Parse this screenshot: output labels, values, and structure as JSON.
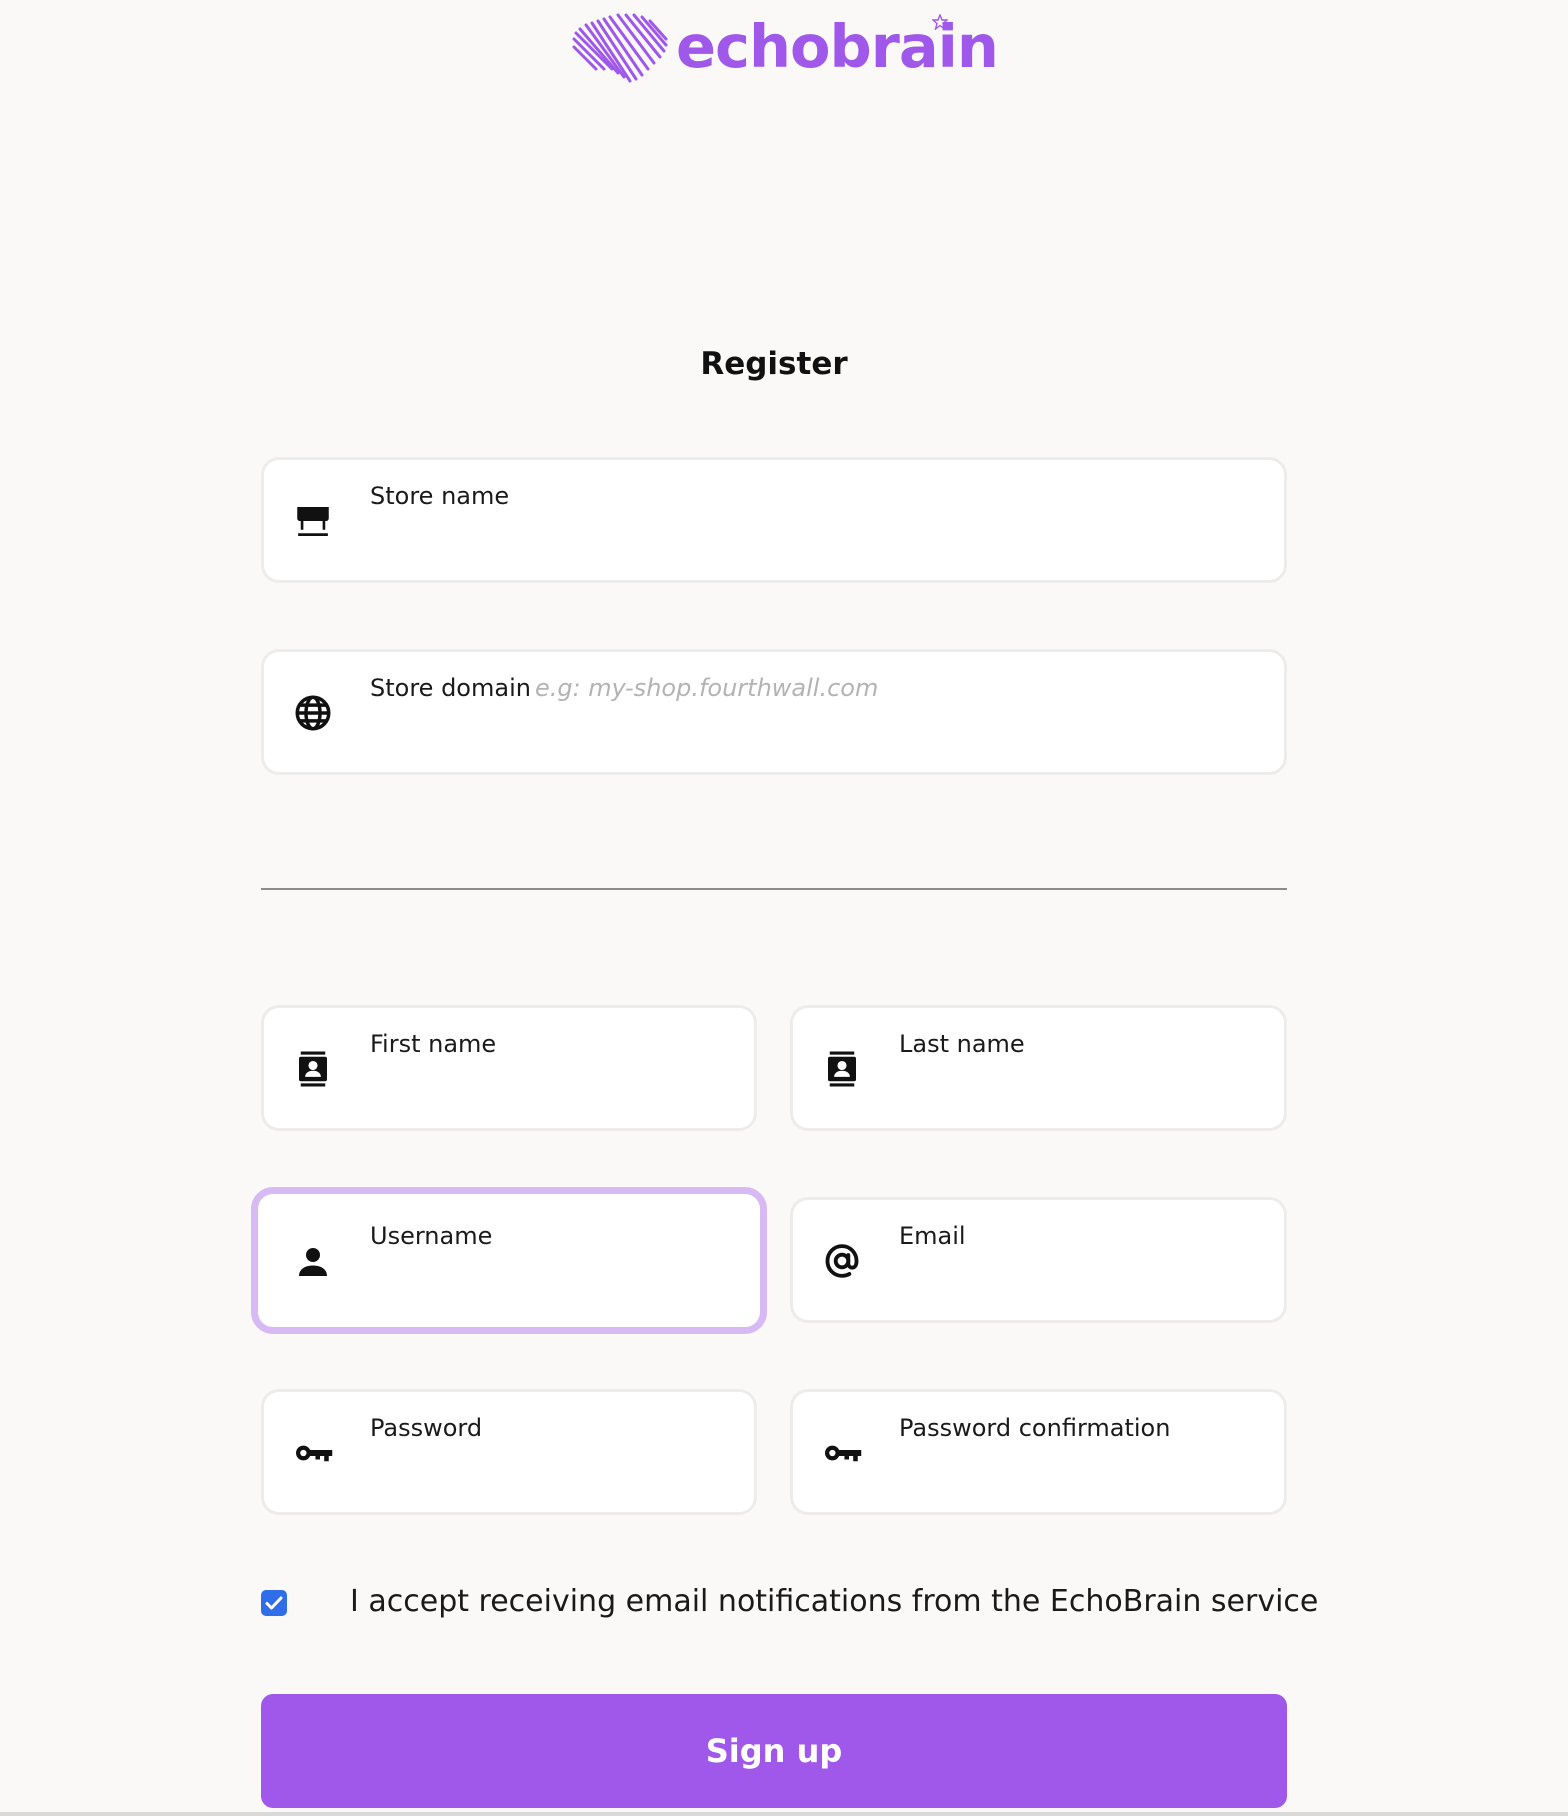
{
  "brand": {
    "name": "echobrain",
    "logo_icon": "soundwave-heart-icon",
    "accent_color": "#9f58ea"
  },
  "form": {
    "title": "Register",
    "store_name": {
      "label": "Store name",
      "icon": "storefront-icon",
      "value": ""
    },
    "store_domain": {
      "label": "Store domain",
      "hint": "e.g: my-shop.fourthwall.com",
      "icon": "globe-icon",
      "value": ""
    },
    "first_name": {
      "label": "First name",
      "icon": "contact-card-icon",
      "value": ""
    },
    "last_name": {
      "label": "Last name",
      "icon": "contact-card-icon",
      "value": ""
    },
    "username": {
      "label": "Username",
      "icon": "person-icon",
      "value": "",
      "focused": true
    },
    "email": {
      "label": "Email",
      "icon": "at-sign-icon",
      "value": ""
    },
    "password": {
      "label": "Password",
      "icon": "key-icon",
      "value": ""
    },
    "password_confirmation": {
      "label": "Password confirmation",
      "icon": "key-icon",
      "value": ""
    },
    "consent": {
      "label": "I accept receiving email notifications from the EchoBrain service",
      "checked": true,
      "checkbox_color": "#2f6ee8"
    },
    "submit_label": "Sign up",
    "focus_ring_color": "#d7b9f3"
  }
}
